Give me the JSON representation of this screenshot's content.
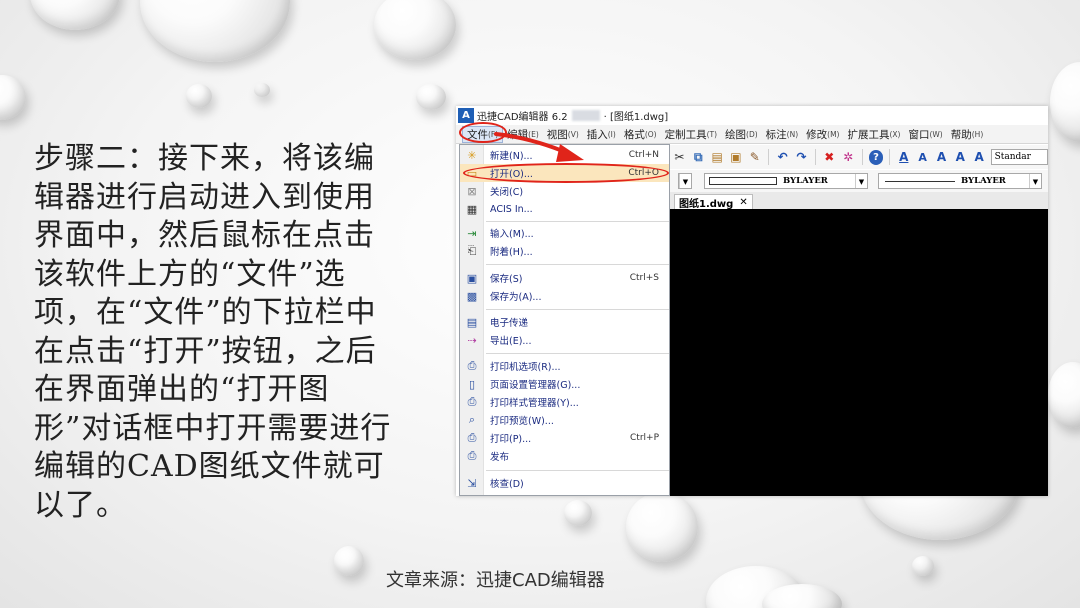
{
  "slide": {
    "body_text": "步骤二：接下来，将该编辑器进行启动进入到使用界面中，然后鼠标在点击该软件上方的“文件”选项，在“文件”的下拉栏中在点击“打开”按钮，之后在界面弹出的“打开图形”对话框中打开需要进行编辑的CAD图纸文件就可以了。",
    "source": "文章来源：迅捷CAD编辑器"
  },
  "app": {
    "icon_text": "A",
    "title_prefix": "迅捷CAD编辑器 6.2",
    "title_suffix": "· [图纸1.dwg]"
  },
  "menubar": [
    {
      "label": "文件",
      "key": "(F)"
    },
    {
      "label": "编辑",
      "key": "(E)"
    },
    {
      "label": "视图",
      "key": "(V)"
    },
    {
      "label": "插入",
      "key": "(I)"
    },
    {
      "label": "格式",
      "key": "(O)"
    },
    {
      "label": "定制工具",
      "key": "(T)"
    },
    {
      "label": "绘图",
      "key": "(D)"
    },
    {
      "label": "标注",
      "key": "(N)"
    },
    {
      "label": "修改",
      "key": "(M)"
    },
    {
      "label": "扩展工具",
      "key": "(X)"
    },
    {
      "label": "窗口",
      "key": "(W)"
    },
    {
      "label": "帮助",
      "key": "(H)"
    }
  ],
  "toolbar": {
    "text_style": "Standar",
    "layer_combo": "BYLAYER",
    "linetype_combo": "BYLAYER"
  },
  "tab": {
    "label": "图纸1.dwg",
    "close": "✕"
  },
  "file_menu": [
    {
      "icon": "new-file-icon",
      "label": "新建(N)...",
      "shortcut": "Ctrl+N"
    },
    {
      "icon": "open-folder-icon",
      "label": "打开(O)...",
      "shortcut": "Ctrl+O",
      "highlight": true
    },
    {
      "icon": "close-icon",
      "label": "关闭(C)",
      "shortcut": ""
    },
    {
      "icon": "acis-icon",
      "label": "ACIS In...",
      "shortcut": ""
    },
    {
      "icon": "import-icon",
      "label": "输入(M)...",
      "shortcut": ""
    },
    {
      "icon": "attach-icon",
      "label": "附着(H)...",
      "shortcut": ""
    },
    {
      "icon": "save-icon",
      "label": "保存(S)",
      "shortcut": "Ctrl+S"
    },
    {
      "icon": "save-as-icon",
      "label": "保存为(A)...",
      "shortcut": ""
    },
    {
      "icon": "etransmit-icon",
      "label": "电子传递",
      "shortcut": ""
    },
    {
      "icon": "export-icon",
      "label": "导出(E)...",
      "shortcut": ""
    },
    {
      "icon": "plotter-options-icon",
      "label": "打印机选项(R)...",
      "shortcut": ""
    },
    {
      "icon": "page-setup-icon",
      "label": "页面设置管理器(G)...",
      "shortcut": ""
    },
    {
      "icon": "plot-style-icon",
      "label": "打印样式管理器(Y)...",
      "shortcut": ""
    },
    {
      "icon": "print-preview-icon",
      "label": "打印预览(W)...",
      "shortcut": ""
    },
    {
      "icon": "print-icon",
      "label": "打印(P)...",
      "shortcut": "Ctrl+P"
    },
    {
      "icon": "publish-icon",
      "label": "发布",
      "shortcut": ""
    },
    {
      "icon": "audit-icon",
      "label": "核查(D)",
      "shortcut": ""
    }
  ],
  "colors": {
    "annotation_red": "#e0241a",
    "highlight": "#fbe6bd",
    "canvas": "#000000"
  }
}
